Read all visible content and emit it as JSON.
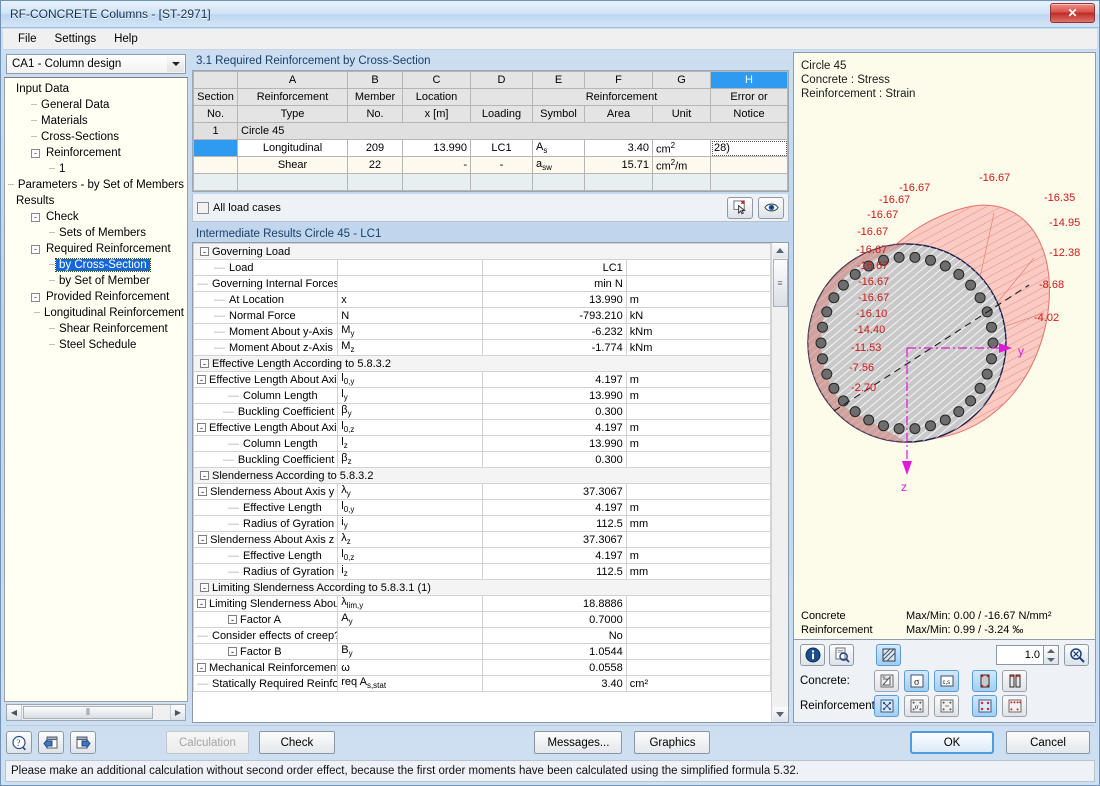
{
  "window": {
    "title": "RF-CONCRETE Columns - [ST-2971]",
    "close_label": "✕"
  },
  "menu": {
    "items": [
      "File",
      "Settings",
      "Help"
    ]
  },
  "combo": {
    "value": "CA1 - Column design"
  },
  "tree": {
    "nodes": [
      {
        "label": "Input Data",
        "depth": 0,
        "toggle": "",
        "selected": false
      },
      {
        "label": "General Data",
        "depth": 1,
        "toggle": "",
        "selected": false
      },
      {
        "label": "Materials",
        "depth": 1,
        "toggle": "",
        "selected": false
      },
      {
        "label": "Cross-Sections",
        "depth": 1,
        "toggle": "",
        "selected": false
      },
      {
        "label": "Reinforcement",
        "depth": 1,
        "toggle": "-",
        "selected": false
      },
      {
        "label": "1",
        "depth": 2,
        "toggle": "",
        "selected": false
      },
      {
        "label": "Parameters - by Set of Members",
        "depth": 1,
        "toggle": "",
        "selected": false
      },
      {
        "label": "Results",
        "depth": 0,
        "toggle": "",
        "selected": false
      },
      {
        "label": "Check",
        "depth": 1,
        "toggle": "-",
        "selected": false
      },
      {
        "label": "Sets of Members",
        "depth": 2,
        "toggle": "",
        "selected": false
      },
      {
        "label": "Required Reinforcement",
        "depth": 1,
        "toggle": "-",
        "selected": false
      },
      {
        "label": "by Cross-Section",
        "depth": 2,
        "toggle": "",
        "selected": true
      },
      {
        "label": "by Set of Member",
        "depth": 2,
        "toggle": "",
        "selected": false
      },
      {
        "label": "Provided Reinforcement",
        "depth": 1,
        "toggle": "-",
        "selected": false
      },
      {
        "label": "Longitudinal Reinforcement",
        "depth": 2,
        "toggle": "",
        "selected": false
      },
      {
        "label": "Shear Reinforcement",
        "depth": 2,
        "toggle": "",
        "selected": false
      },
      {
        "label": "Steel Schedule",
        "depth": 2,
        "toggle": "",
        "selected": false
      }
    ]
  },
  "main": {
    "section_title": "3.1 Required Reinforcement by Cross-Section",
    "table": {
      "letter_headers": [
        "",
        "A",
        "B",
        "C",
        "D",
        "E",
        "F",
        "G",
        "H"
      ],
      "header_line1": [
        "Section",
        "Reinforcement",
        "Member",
        "Location",
        "",
        "",
        "Reinforcement",
        "",
        "Error or"
      ],
      "header_group_reinforcement": "Reinforcement",
      "header_line2": [
        "No.",
        "Type",
        "No.",
        "x [m]",
        "Loading",
        "Symbol",
        "Area",
        "Unit",
        "Notice"
      ],
      "group_row": {
        "no": "1",
        "label": "Circle 45"
      },
      "rows": [
        {
          "no": "",
          "type": "Longitudinal",
          "member": "209",
          "location": "13.990",
          "loading": "LC1",
          "symbol_main": "A",
          "symbol_sub": "s",
          "area": "3.40",
          "unit_main": "cm",
          "unit_sup": "2",
          "unit_suffix": "",
          "error": "28)"
        },
        {
          "no": "",
          "type": "Shear",
          "member": "22",
          "location": "-",
          "loading": "-",
          "symbol_main": "a",
          "symbol_sub": "sw",
          "area": "15.71",
          "unit_main": "cm",
          "unit_sup": "2",
          "unit_suffix": "/m",
          "error": ""
        }
      ]
    },
    "load_cases": {
      "checkbox_label": "All load cases",
      "checked": false
    }
  },
  "intermediate": {
    "title": "Intermediate Results Circle 45 - LC1",
    "rows": [
      {
        "desc": "Governing Load",
        "indent": 0,
        "toggle": "-",
        "sym": "",
        "sym_sub": "",
        "val": "",
        "unit": "",
        "group": true
      },
      {
        "desc": "Load",
        "indent": 1,
        "toggle": "",
        "sym": "",
        "sym_sub": "",
        "val": "LC1",
        "unit": "",
        "group": false
      },
      {
        "desc": "Governing Internal Forces",
        "indent": 1,
        "toggle": "",
        "sym": "",
        "sym_sub": "",
        "val": "min N",
        "unit": "",
        "group": false
      },
      {
        "desc": "At Location",
        "indent": 1,
        "toggle": "",
        "sym": "x",
        "sym_sub": "",
        "val": "13.990",
        "unit": "m",
        "group": false
      },
      {
        "desc": "Normal Force",
        "indent": 1,
        "toggle": "",
        "sym": "N",
        "sym_sub": "",
        "val": "-793.210",
        "unit": "kN",
        "group": false
      },
      {
        "desc": "Moment About y-Axis",
        "indent": 1,
        "toggle": "",
        "sym": "M",
        "sym_sub": "y",
        "val": "-6.232",
        "unit": "kNm",
        "group": false
      },
      {
        "desc": "Moment About z-Axis",
        "indent": 1,
        "toggle": "",
        "sym": "M",
        "sym_sub": "z",
        "val": "-1.774",
        "unit": "kNm",
        "group": false
      },
      {
        "desc": "Effective Length According to 5.8.3.2",
        "indent": 0,
        "toggle": "-",
        "sym": "",
        "sym_sub": "",
        "val": "",
        "unit": "",
        "group": true
      },
      {
        "desc": "Effective Length About Axis y",
        "indent": 1,
        "toggle": "-",
        "sym": "l",
        "sym_sub": "0,y",
        "val": "4.197",
        "unit": "m",
        "group": false
      },
      {
        "desc": "Column Length",
        "indent": 2,
        "toggle": "",
        "sym": "l",
        "sym_sub": "y",
        "val": "13.990",
        "unit": "m",
        "group": false
      },
      {
        "desc": "Buckling Coefficient",
        "indent": 2,
        "toggle": "",
        "sym": "β",
        "sym_sub": "y",
        "val": "0.300",
        "unit": "",
        "group": false
      },
      {
        "desc": "Effective Length About Axis z",
        "indent": 1,
        "toggle": "-",
        "sym": "l",
        "sym_sub": "0,z",
        "val": "4.197",
        "unit": "m",
        "group": false
      },
      {
        "desc": "Column Length",
        "indent": 2,
        "toggle": "",
        "sym": "l",
        "sym_sub": "z",
        "val": "13.990",
        "unit": "m",
        "group": false
      },
      {
        "desc": "Buckling Coefficient",
        "indent": 2,
        "toggle": "",
        "sym": "β",
        "sym_sub": "z",
        "val": "0.300",
        "unit": "",
        "group": false
      },
      {
        "desc": "Slenderness According to 5.8.3.2",
        "indent": 0,
        "toggle": "-",
        "sym": "",
        "sym_sub": "",
        "val": "",
        "unit": "",
        "group": true
      },
      {
        "desc": "Slenderness About Axis y",
        "indent": 1,
        "toggle": "-",
        "sym": "λ",
        "sym_sub": "y",
        "val": "37.3067",
        "unit": "",
        "group": false
      },
      {
        "desc": "Effective Length",
        "indent": 2,
        "toggle": "",
        "sym": "l",
        "sym_sub": "0,y",
        "val": "4.197",
        "unit": "m",
        "group": false
      },
      {
        "desc": "Radius of Gyration",
        "indent": 2,
        "toggle": "",
        "sym": "i",
        "sym_sub": "y",
        "val": "112.5",
        "unit": "mm",
        "group": false
      },
      {
        "desc": "Slenderness About Axis z",
        "indent": 1,
        "toggle": "-",
        "sym": "λ",
        "sym_sub": "z",
        "val": "37.3067",
        "unit": "",
        "group": false
      },
      {
        "desc": "Effective Length",
        "indent": 2,
        "toggle": "",
        "sym": "l",
        "sym_sub": "0,z",
        "val": "4.197",
        "unit": "m",
        "group": false
      },
      {
        "desc": "Radius of Gyration",
        "indent": 2,
        "toggle": "",
        "sym": "i",
        "sym_sub": "z",
        "val": "112.5",
        "unit": "mm",
        "group": false
      },
      {
        "desc": "Limiting Slenderness According to 5.8.3.1 (1)",
        "indent": 0,
        "toggle": "-",
        "sym": "",
        "sym_sub": "",
        "val": "",
        "unit": "",
        "group": true
      },
      {
        "desc": "Limiting Slenderness About Axis y",
        "indent": 1,
        "toggle": "-",
        "sym": "λ",
        "sym_sub": "lim,y",
        "val": "18.8886",
        "unit": "",
        "group": false
      },
      {
        "desc": "Factor A",
        "indent": 2,
        "toggle": "-",
        "sym": "A",
        "sym_sub": "y",
        "val": "0.7000",
        "unit": "",
        "group": false
      },
      {
        "desc": "Consider effects of creep?",
        "indent": 3,
        "toggle": "",
        "sym": "",
        "sym_sub": "",
        "val": "No",
        "unit": "",
        "group": false
      },
      {
        "desc": "Factor B",
        "indent": 2,
        "toggle": "-",
        "sym": "B",
        "sym_sub": "y",
        "val": "1.0544",
        "unit": "",
        "group": false
      },
      {
        "desc": "Mechanical Reinforcement Ratio",
        "indent": 3,
        "toggle": "-",
        "sym": "ω",
        "sym_sub": "",
        "val": "0.0558",
        "unit": "",
        "group": false
      },
      {
        "desc": "Statically Required Reinforcement",
        "indent": 4,
        "toggle": "",
        "sym": "req A",
        "sym_sub": "s,stat",
        "val": "3.40",
        "unit": "cm²",
        "group": false
      }
    ]
  },
  "graphic": {
    "caption_lines": [
      "Circle 45",
      "Concrete : Stress",
      "Reinforcement : Strain"
    ],
    "axis_y_label": "y",
    "axis_z_label": "z",
    "stress_values": [
      "-16.67",
      "-16.67",
      "-16.67",
      "-16.67",
      "-16.67",
      "-16.67",
      "-16.67",
      "-16.67",
      "-16.10",
      "-14.40",
      "-11.53",
      "-7.56",
      "-2.70"
    ],
    "edge_values": [
      "-16.67",
      "-16.35",
      "-14.95",
      "-12.38",
      "-8.68",
      "-4.02"
    ],
    "stats": [
      {
        "label": "Concrete",
        "value": "Max/Min: 0.00 / -16.67 N/mm²"
      },
      {
        "label": "Reinforcement",
        "value": "Max/Min: 0.99 /  -3.24 ‰"
      }
    ],
    "scale_value": "1.0",
    "concrete_label": "Concrete:",
    "reinforcement_label": "Reinforcement:"
  },
  "footer": {
    "buttons": {
      "calculation": "Calculation",
      "check": "Check",
      "messages": "Messages...",
      "graphics": "Graphics",
      "ok": "OK",
      "cancel": "Cancel"
    },
    "status": "Please make an additional calculation without second order effect, because the first order moments have been calculated using the simplified formula 5.32."
  }
}
